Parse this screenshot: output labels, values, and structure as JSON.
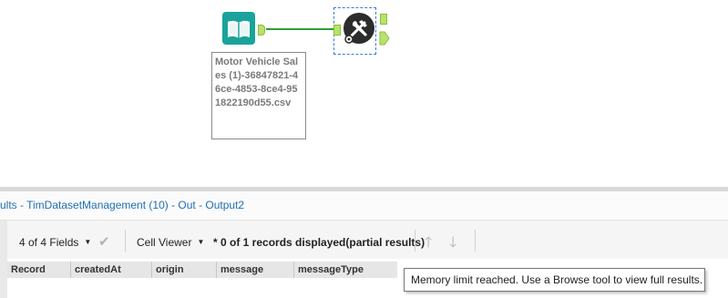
{
  "canvas": {
    "input_tool": {
      "icon": "book-icon",
      "color": "#1aa39a"
    },
    "output_tool": {
      "icon": "wrench-hammer-icon",
      "color": "#2c2c2c"
    },
    "annotation": "Motor Vehicle Sales (1)-36847821-46ce-4853-8ce4-951822190d55.csv",
    "connection_color": "#2f9d3a",
    "anchor_color": "#b7e36b"
  },
  "results": {
    "title": "ults - TimDatasetManagement (10) - Out - Output2",
    "toolbar": {
      "fields_label": "4 of 4 Fields",
      "cell_viewer_label": "Cell Viewer",
      "records_status": "* 0 of 1 records displayed(partial results)"
    },
    "columns": [
      "Record",
      "createdAt",
      "origin",
      "message",
      "messageType"
    ],
    "tooltip": "Memory limit reached. Use a Browse tool to view full results."
  }
}
